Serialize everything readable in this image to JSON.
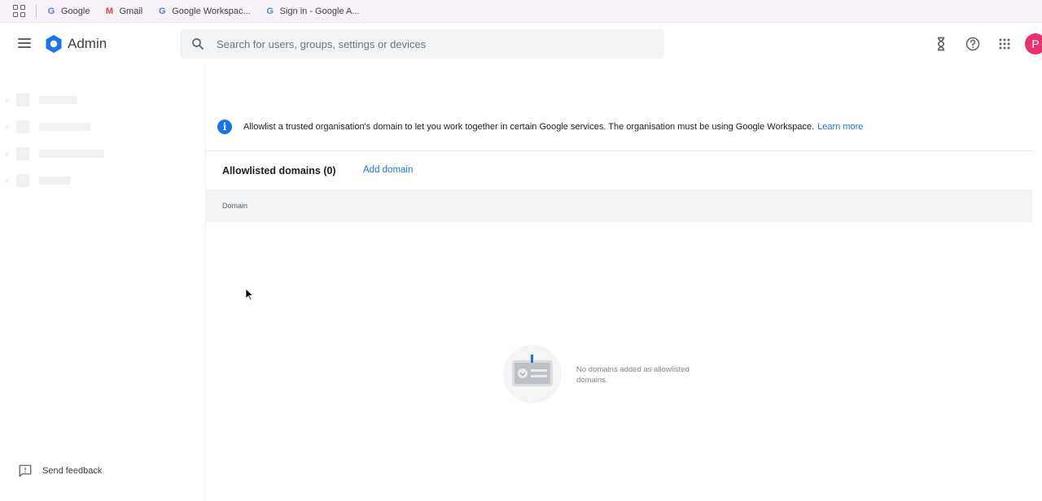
{
  "bookmarks": [
    {
      "label": "Google",
      "icon": "google-g-icon"
    },
    {
      "label": "Gmail",
      "icon": "gmail-m-icon"
    },
    {
      "label": "Google Workspac...",
      "icon": "google-g-icon"
    },
    {
      "label": "Sign in - Google A...",
      "icon": "google-g-icon"
    }
  ],
  "header": {
    "brand": "Admin",
    "search_placeholder": "Search for users, groups, settings or devices",
    "avatar_letter": "P"
  },
  "sidebar": {
    "feedback_label": "Send feedback"
  },
  "main": {
    "info_text": "Allowlist a trusted organisation's domain to let you work together in certain Google services. The organisation must be using Google Workspace.",
    "learn_more": "Learn more",
    "domains_title": "Allowlisted domains (0)",
    "add_domain": "Add domain",
    "column_domain": "Domain",
    "empty_text": "No domains added as allowlisted domains."
  },
  "colors": {
    "accent": "#1a73e8",
    "avatar": "#e8336f"
  }
}
